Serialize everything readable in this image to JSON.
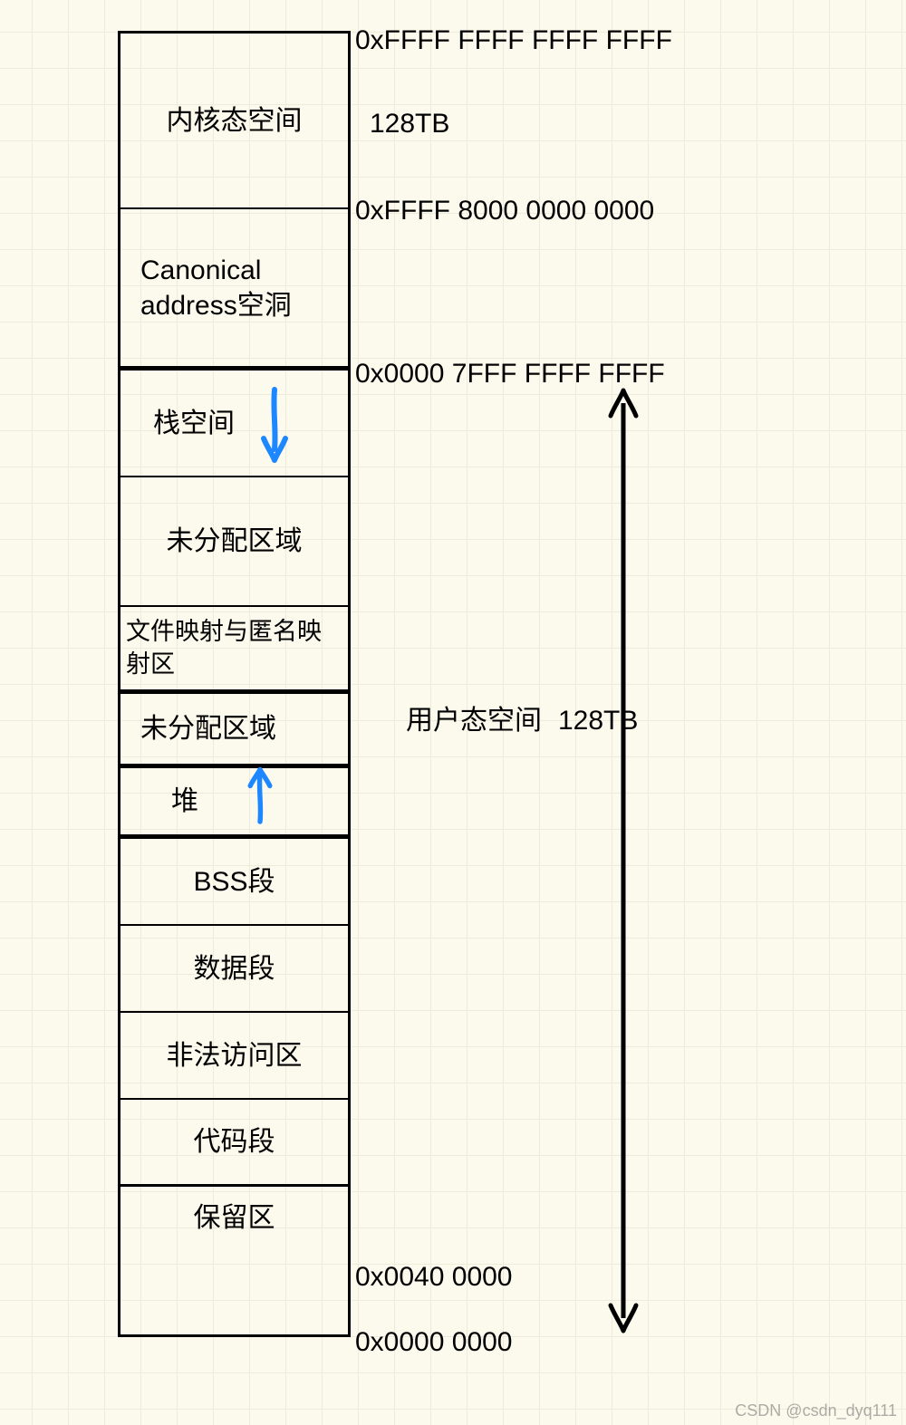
{
  "regions": {
    "kernel": "内核态空间",
    "hole": "Canonical address空洞",
    "stack": "栈空间",
    "unalloc1": "未分配区域",
    "mmap": "文件映射与匿名映射区",
    "unalloc2": "未分配区域",
    "heap": "堆",
    "bss": "BSS段",
    "dataseg": "数据段",
    "illegal": "非法访问区",
    "code": "代码段",
    "reserved": "保留区"
  },
  "addresses": {
    "top": "0xFFFF FFFF FFFF FFFF",
    "kernel_size": "128TB",
    "kernel_base": "0xFFFF 8000 0000 0000",
    "user_top": "0x0000 7FFF FFFF FFFF",
    "user_label": "用户态空间",
    "user_size": "128TB",
    "code_base": "0x0040 0000",
    "bottom": "0x0000 0000"
  },
  "watermark": "CSDN @csdn_dyq111"
}
